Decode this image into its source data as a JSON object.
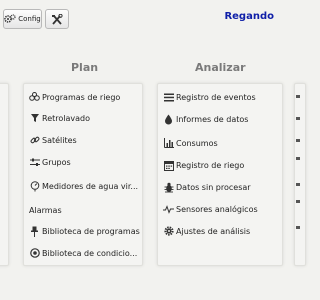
{
  "toolbar": {
    "config_label": "Config"
  },
  "status": {
    "label": "Regando"
  },
  "plan": {
    "heading": "Plan",
    "items": [
      {
        "label": "Programas de riego",
        "icon": "drops-icon"
      },
      {
        "label": "Retrolavado",
        "icon": "funnel-icon"
      },
      {
        "label": "Satélites",
        "icon": "link-icon"
      },
      {
        "label": "Grupos",
        "icon": "sliders-icon"
      },
      {
        "label": "Medidores de agua vir...",
        "icon": "meter-icon"
      }
    ],
    "section": "Alarmas",
    "section_items": [
      {
        "label": "Biblioteca de programas",
        "icon": "pin-icon"
      },
      {
        "label": "Biblioteca de condicio...",
        "icon": "target-icon"
      }
    ]
  },
  "analyze": {
    "heading": "Analizar",
    "items": [
      {
        "label": "Registro de eventos",
        "icon": "list-icon"
      },
      {
        "label": "Informes de datos",
        "icon": "drop-icon"
      },
      {
        "label": "Consumos",
        "icon": "bar-chart-icon"
      },
      {
        "label": "Registro de riego",
        "icon": "calendar-icon"
      },
      {
        "label": "Datos sin procesar",
        "icon": "bug-icon"
      },
      {
        "label": "Sensores analógicos",
        "icon": "wave-icon"
      },
      {
        "label": "Ajustes de análisis",
        "icon": "gear-icon"
      }
    ]
  }
}
